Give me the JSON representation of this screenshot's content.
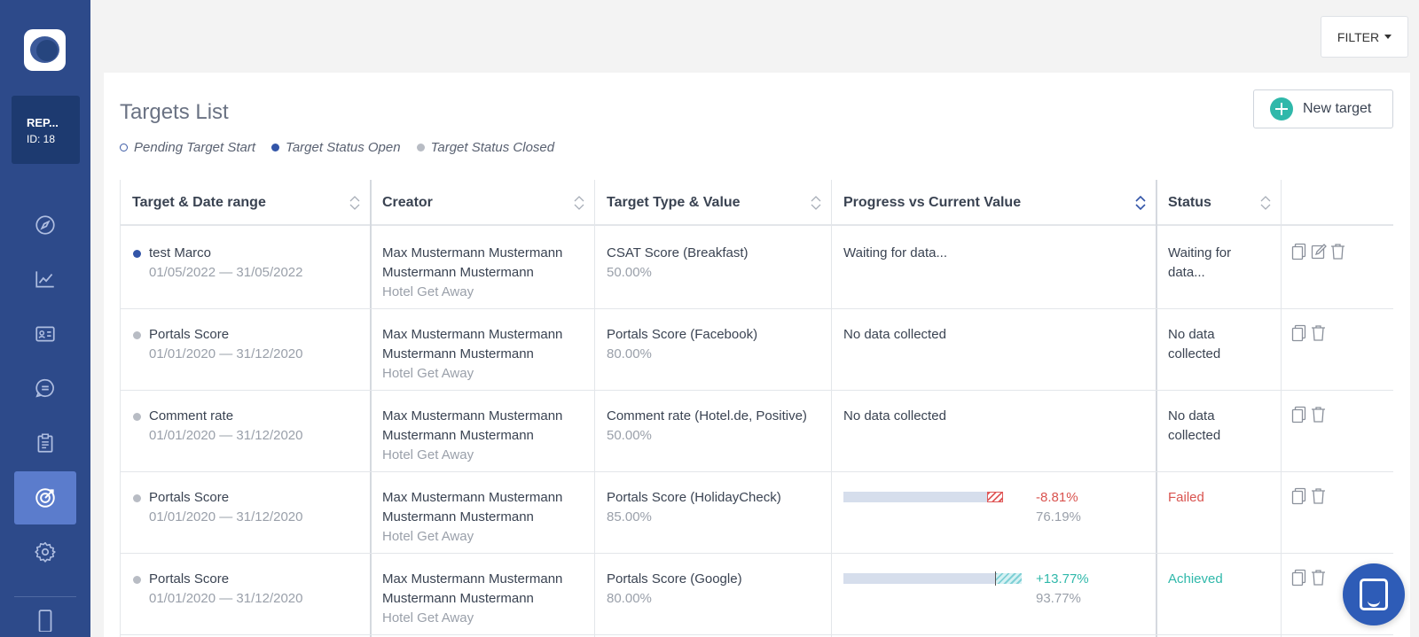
{
  "sidebar": {
    "property": {
      "name": "REP...",
      "id": "ID: 18"
    },
    "items": [
      {
        "icon": "compass-icon",
        "active": false
      },
      {
        "icon": "chart-line-icon",
        "active": false
      },
      {
        "icon": "id-card-icon",
        "active": false
      },
      {
        "icon": "chat-bubble-icon",
        "active": false
      },
      {
        "icon": "clipboard-icon",
        "active": false
      },
      {
        "icon": "target-icon",
        "active": true
      },
      {
        "icon": "gear-icon",
        "active": false
      },
      {
        "icon": "mobile-icon",
        "active": false
      }
    ]
  },
  "toolbar": {
    "filter_label": "FILTER"
  },
  "page": {
    "title": "Targets List",
    "new_target_label": "New target",
    "legend": {
      "pending": "Pending Target Start",
      "open": "Target Status Open",
      "closed": "Target Status Closed"
    }
  },
  "table": {
    "columns": {
      "target": "Target & Date range",
      "creator": "Creator",
      "type": "Target Type & Value",
      "progress": "Progress vs Current Value",
      "status": "Status"
    },
    "rows": [
      {
        "name": "test Marco",
        "dates": "01/05/2022 — 31/05/2022",
        "state": "open",
        "creator_line1": "Max Mustermann Mustermann",
        "creator_line2": "Mustermann Mustermann",
        "hotel": "Hotel Get Away",
        "type": "CSAT Score (Breakfast)",
        "value": "50.00%",
        "progress_text": "Waiting for data...",
        "status_line1": "Waiting for",
        "status_line2": "data...",
        "actions": [
          "copy-icon",
          "edit-icon",
          "trash-icon"
        ]
      },
      {
        "name": "Portals Score",
        "dates": "01/01/2020 — 31/12/2020",
        "state": "closed",
        "creator_line1": "Max Mustermann Mustermann",
        "creator_line2": "Mustermann Mustermann",
        "hotel": "Hotel Get Away",
        "type": "Portals Score (Facebook)",
        "value": "80.00%",
        "progress_text": "No data collected",
        "status_line1": "No data",
        "status_line2": "collected",
        "actions": [
          "copy-icon",
          "trash-icon"
        ]
      },
      {
        "name": "Comment rate",
        "dates": "01/01/2020 — 31/12/2020",
        "state": "closed",
        "creator_line1": "Max Mustermann Mustermann",
        "creator_line2": "Mustermann Mustermann",
        "hotel": "Hotel Get Away",
        "type": "Comment rate (Hotel.de, Positive)",
        "value": "50.00%",
        "progress_text": "No data collected",
        "status_line1": "No data",
        "status_line2": "collected",
        "actions": [
          "copy-icon",
          "trash-icon"
        ]
      },
      {
        "name": "Portals Score",
        "dates": "01/01/2020 — 31/12/2020",
        "state": "closed",
        "creator_line1": "Max Mustermann Mustermann",
        "creator_line2": "Mustermann Mustermann",
        "hotel": "Hotel Get Away",
        "type": "Portals Score (HolidayCheck)",
        "value": "85.00%",
        "progress_diff": "-8.81%",
        "progress_current": "76.19%",
        "status": "Failed",
        "actions": [
          "copy-icon",
          "trash-icon"
        ]
      },
      {
        "name": "Portals Score",
        "dates": "01/01/2020 — 31/12/2020",
        "state": "closed",
        "creator_line1": "Max Mustermann Mustermann",
        "creator_line2": "Mustermann Mustermann",
        "hotel": "Hotel Get Away",
        "type": "Portals Score (Google)",
        "value": "80.00%",
        "progress_diff": "+13.77%",
        "progress_current": "93.77%",
        "status": "Achieved",
        "actions": [
          "copy-icon",
          "trash-icon"
        ]
      }
    ]
  },
  "colors": {
    "sidebar": "#2d4a8a",
    "sidebar_active": "#5b7ccc",
    "accent": "#2fb8aa",
    "failed": "#d9534f",
    "open_dot": "#3355a8"
  }
}
